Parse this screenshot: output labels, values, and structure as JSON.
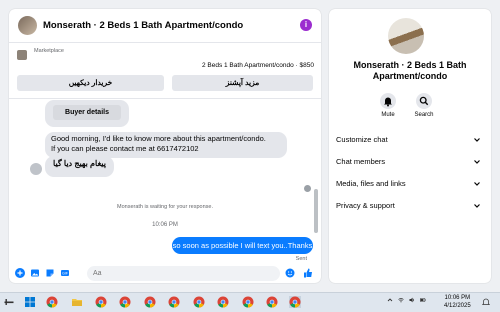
{
  "chat": {
    "title": "Monserath · 2 Beds 1 Bath Apartment/condo",
    "marketplace": {
      "label": "Marketplace",
      "listing": "2 Beds 1 Bath Apartment/condo · $850",
      "btn_left": "خریدار دیکهیں",
      "btn_right": "مزید آپشنز"
    },
    "buyer_details_label": "Buyer details",
    "messages": {
      "incoming_1_line1": "Good morning, I'd like to know more about this apartment/condo.",
      "incoming_1_line2": "If you can please contact me at 6617472102",
      "incoming_2": "پیغام بھیج دیا گیا",
      "status": "Monserath is waiting for your response.",
      "timestamp": "10:06 PM",
      "outgoing": "so soon as possible I will text you..Thanks",
      "sent_label": "Sent"
    },
    "composer": {
      "placeholder": "Aa"
    }
  },
  "info": {
    "title_line1": "Monserath · 2 Beds 1 Bath",
    "title_line2": "Apartment/condo",
    "actions": [
      {
        "label": "Mute",
        "icon": "bell-icon"
      },
      {
        "label": "Search",
        "icon": "search-icon"
      }
    ],
    "sections": [
      "Customize chat",
      "Chat members",
      "Media, files and links",
      "Privacy & support"
    ]
  },
  "taskbar": {
    "time": "10:06 PM",
    "date": "4/12/2025",
    "apps": [
      "windows-start-icon",
      "chrome-icon",
      "file-explorer-icon",
      "chrome-profile-icon",
      "chrome-profile-icon",
      "chrome-profile-icon",
      "chrome-profile-icon",
      "chrome-profile-icon",
      "chrome-profile-icon",
      "chrome-profile-icon",
      "chrome-profile-icon"
    ]
  },
  "colors": {
    "accent": "#0a7cff",
    "info_purple": "#9b2ccf",
    "bubble_gray": "#e4e6eb",
    "page_bg": "#eef0f3"
  }
}
